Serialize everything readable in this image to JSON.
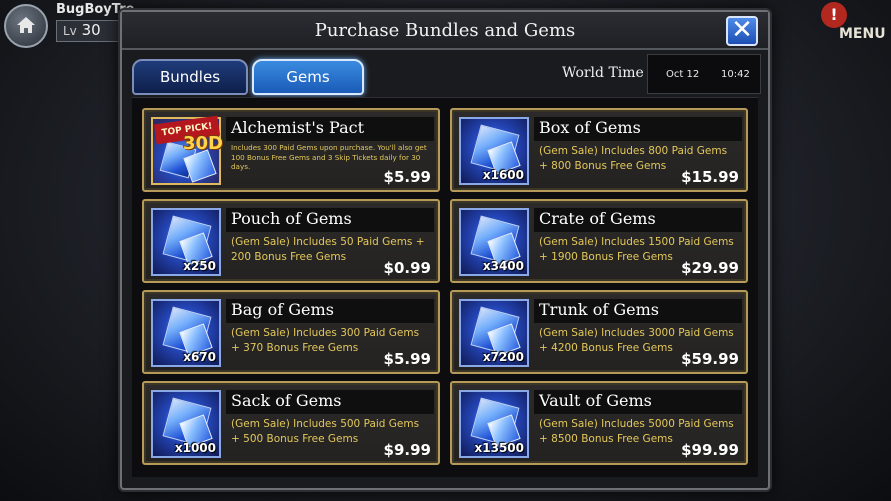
{
  "hud": {
    "player_name": "BugBoyTre",
    "level_label": "Lv",
    "level_value": "30",
    "menu_label": "MENU",
    "alert_symbol": "!"
  },
  "dialog": {
    "title": "Purchase Bundles and Gems",
    "close_symbol": "✕",
    "tabs": [
      {
        "label": "Bundles",
        "selected": false
      },
      {
        "label": "Gems",
        "selected": true
      }
    ],
    "world_time": {
      "label": "World Time",
      "date": "Oct 12",
      "time": "10:42"
    }
  },
  "products": [
    {
      "name": "Alchemist's Pact",
      "desc": "Includes 300 Paid Gems upon purchase. You'll also get 100 Bonus Free Gems and 3 Skip Tickets daily for 30 days.",
      "price": "$5.99",
      "qty": "",
      "badge": "TOP PICK!",
      "days": "30D",
      "icon": "alchemist-pact-icon"
    },
    {
      "name": "Box of Gems",
      "desc": "(Gem Sale) Includes 800 Paid Gems + 800 Bonus Free Gems",
      "price": "$15.99",
      "qty": "x1600",
      "icon": "gem-icon"
    },
    {
      "name": "Pouch of Gems",
      "desc": "(Gem Sale) Includes 50 Paid Gems + 200 Bonus Free Gems",
      "price": "$0.99",
      "qty": "x250",
      "icon": "gem-icon"
    },
    {
      "name": "Crate of Gems",
      "desc": "(Gem Sale) Includes 1500 Paid Gems + 1900 Bonus Free Gems",
      "price": "$29.99",
      "qty": "x3400",
      "icon": "gem-icon"
    },
    {
      "name": "Bag of Gems",
      "desc": "(Gem Sale) Includes 300 Paid Gems + 370 Bonus Free Gems",
      "price": "$5.99",
      "qty": "x670",
      "icon": "gem-icon"
    },
    {
      "name": "Trunk of Gems",
      "desc": "(Gem Sale) Includes 3000 Paid Gems + 4200 Bonus Free Gems",
      "price": "$59.99",
      "qty": "x7200",
      "icon": "gem-icon"
    },
    {
      "name": "Sack of Gems",
      "desc": "(Gem Sale) Includes 500 Paid Gems + 500 Bonus Free Gems",
      "price": "$9.99",
      "qty": "x1000",
      "icon": "gem-icon"
    },
    {
      "name": "Vault of Gems",
      "desc": "(Gem Sale) Includes 5000 Paid Gems + 8500 Bonus Free Gems",
      "price": "$99.99",
      "qty": "x13500",
      "icon": "gem-icon"
    }
  ]
}
